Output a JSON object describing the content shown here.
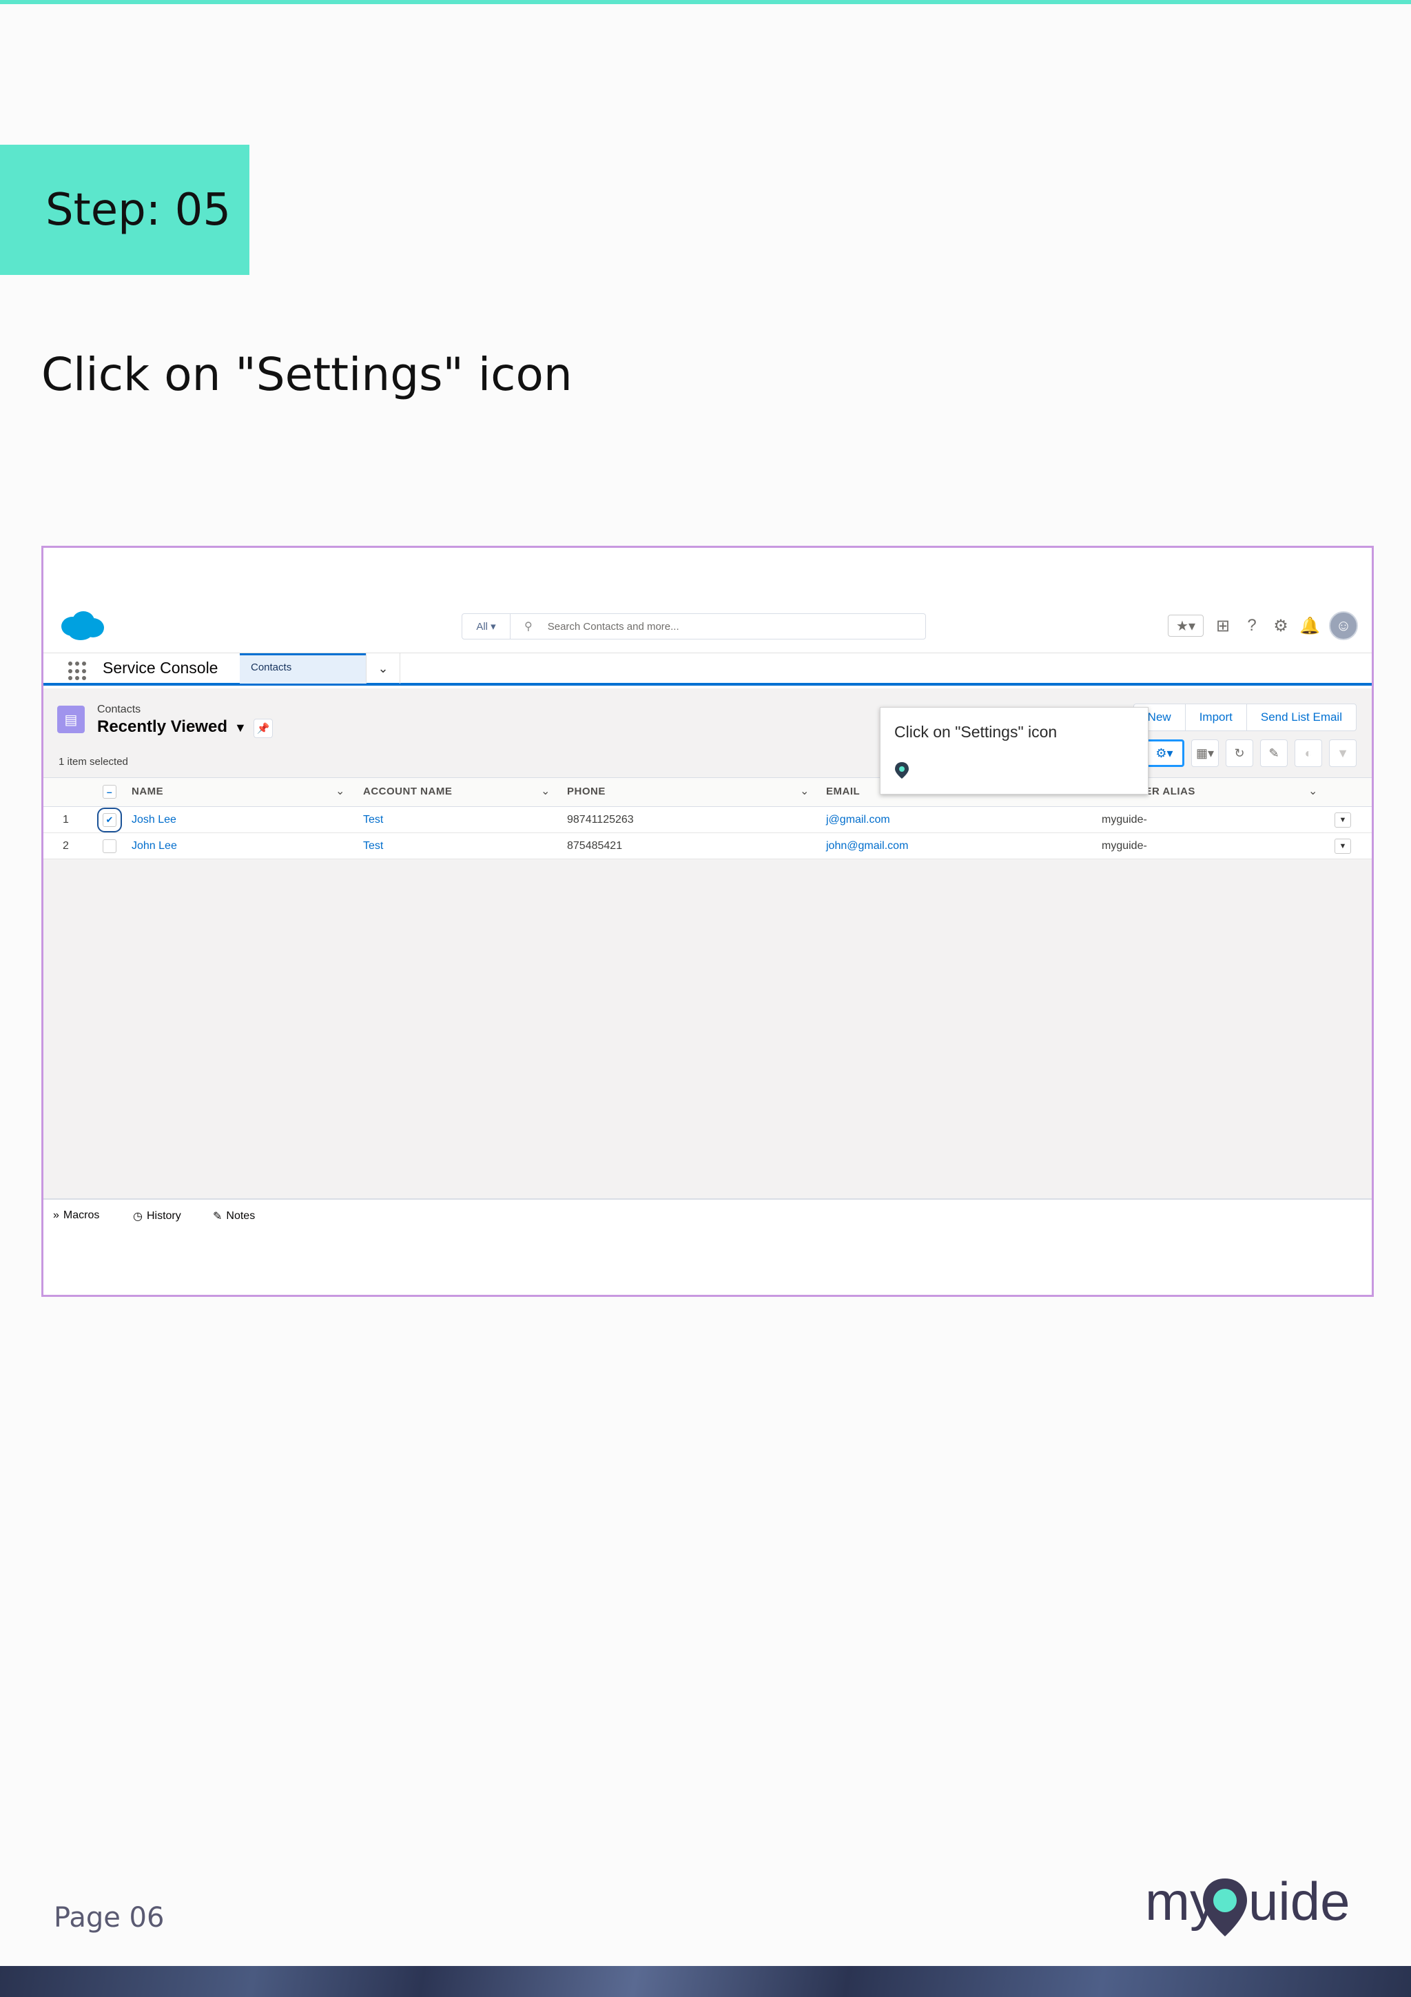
{
  "step": {
    "label": "Step: 05"
  },
  "instruction": "Click on \"Settings\" icon",
  "page_number": "Page 06",
  "brand": {
    "name": "myGuide"
  },
  "salesforce": {
    "search": {
      "scope": "All ▾",
      "placeholder": "Search Contacts and more..."
    },
    "header_icons": [
      "favorites-icon",
      "global-actions-icon",
      "help-icon",
      "setup-gear-icon",
      "notifications-bell-icon",
      "avatar"
    ],
    "app_name": "Service Console",
    "workspace_tab": "Contacts",
    "list_view": {
      "object_label": "Contacts",
      "title": "Recently Viewed",
      "status": "1 item selected",
      "buttons": [
        "New",
        "Import",
        "Send List Email"
      ],
      "columns": [
        "NAME",
        "ACCOUNT NAME",
        "PHONE",
        "EMAIL",
        "T OWNER ALIAS"
      ],
      "rows": [
        {
          "num": "1",
          "selected": true,
          "name": "Josh Lee",
          "account": "Test",
          "phone": "98741125263",
          "email": "j@gmail.com",
          "owner": "myguide-"
        },
        {
          "num": "2",
          "selected": false,
          "name": "John Lee",
          "account": "Test",
          "phone": "875485421",
          "email": "john@gmail.com",
          "owner": "myguide-"
        }
      ]
    },
    "utility_bar": [
      "Macros",
      "History",
      "Notes"
    ],
    "tooltip": {
      "text": "Click on \"Settings\" icon"
    }
  },
  "colors": {
    "accent": "#5ce6cc",
    "frame": "#c898e0",
    "salesforce_blue": "#0070d2",
    "link": "#006dcc"
  }
}
